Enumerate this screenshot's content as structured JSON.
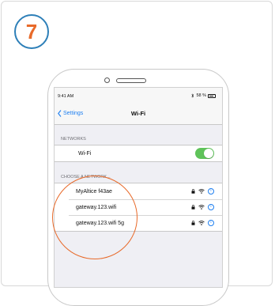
{
  "step": {
    "number": "7",
    "badge_color": "#2d7fb8",
    "number_color": "#e86a2a"
  },
  "status_bar": {
    "time": "9:41 AM",
    "bluetooth": "bluetooth-icon",
    "battery_percent": "58 %",
    "battery_icon": "battery-icon"
  },
  "nav": {
    "back_label": "Settings",
    "back_icon": "chevron-left-icon",
    "title": "Wi-Fi"
  },
  "networks_section": {
    "header": "NETWORKS",
    "wifi_label": "Wi-Fi",
    "wifi_enabled": true,
    "toggle_color": "#5fc35a"
  },
  "choose_section": {
    "header": "CHOOSE A NETWORK...",
    "networks": [
      {
        "name": "MyAltice f43ae",
        "locked": true,
        "icons": [
          "lock-icon",
          "wifi-icon",
          "info-icon"
        ]
      },
      {
        "name": "gateway.123.wifi",
        "locked": true,
        "icons": [
          "lock-icon",
          "wifi-icon",
          "info-icon"
        ]
      },
      {
        "name": "gateway.123.wifi 5g",
        "locked": true,
        "icons": [
          "lock-icon",
          "wifi-icon",
          "info-icon"
        ]
      }
    ]
  },
  "colors": {
    "accent": "#1e7ff0",
    "highlight": "#e86a2a"
  }
}
